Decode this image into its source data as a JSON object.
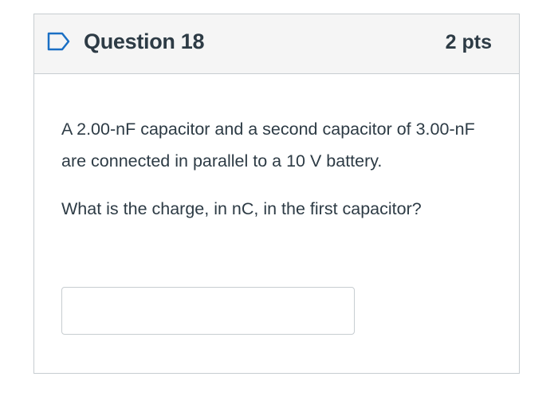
{
  "question": {
    "title": "Question 18",
    "points": "2 pts",
    "paragraphs": [
      "A 2.00-nF capacitor and a second capacitor of 3.00-nF are connected in parallel to a 10 V battery.",
      "What is the charge, in nC, in the first capacitor?"
    ],
    "answer_value": "",
    "flag_icon": "flag-outline-icon",
    "icon_color": "#1a6fc4"
  }
}
